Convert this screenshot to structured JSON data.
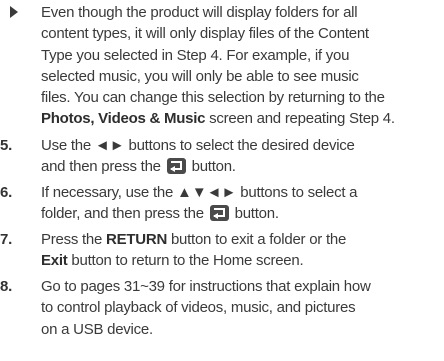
{
  "note": {
    "line1": "Even though the product will display folders for all",
    "line2": "content types, it will only display files of the Content",
    "line3": "Type you selected in Step 4. For example, if you",
    "line4": "selected music, you will only be able to see music",
    "line5": "files. You can change this selection by returning to the",
    "line6_bold": "Photos, Videos & Music",
    "line6_rest": " screen and repeating Step 4."
  },
  "steps": [
    {
      "number": "5.",
      "a": "Use the ",
      "arrows": "◄►",
      "b": " buttons to select the desired device",
      "c": "and then press the ",
      "d": " button."
    },
    {
      "number": "6.",
      "a": "If necessary, use the ",
      "arrows": "▲▼◄►",
      "b": " buttons to select a",
      "c": "folder, and then press the ",
      "d": " button."
    },
    {
      "number": "7.",
      "a": "Press the ",
      "bold1": "RETURN",
      "b": " button to exit a folder or the",
      "bold2": "Exit",
      "c": " button to return to the Home screen."
    },
    {
      "number": "8.",
      "line1": "Go to pages 31~39 for instructions that explain how",
      "line2": "to control playback of videos, music, and pictures",
      "line3": "on a USB device."
    }
  ]
}
